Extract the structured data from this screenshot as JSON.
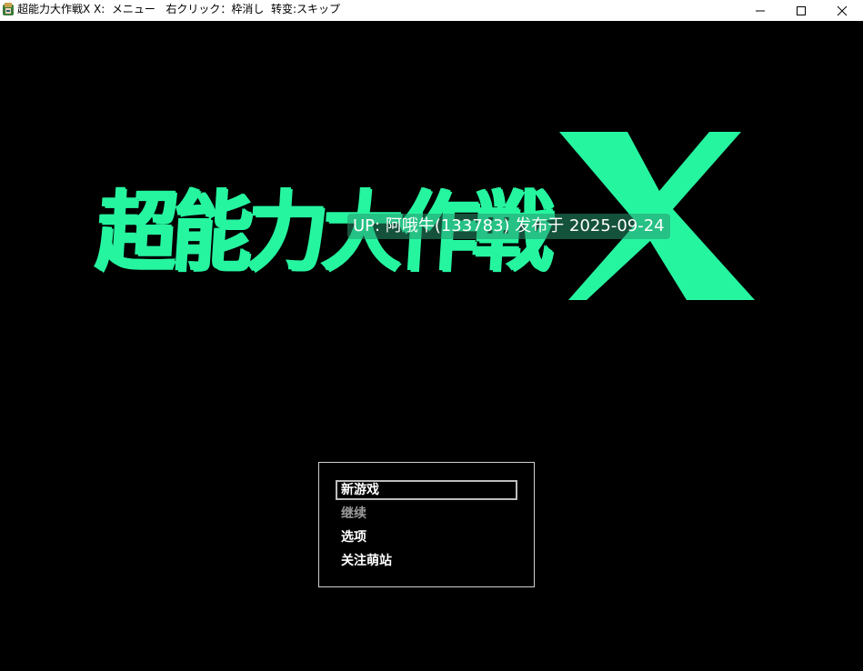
{
  "window": {
    "title": "超能力大作戦X X:  メニュー   右クリック：枠消し  转变:スキップ",
    "min_glyph": "—",
    "max_glyph": "☐",
    "close_glyph": "✕"
  },
  "logo": {
    "text": "超能力大作戦",
    "x_letter": "X",
    "color": "#26f5a0"
  },
  "uploader_badge": "UP: 阿哦牛(133783) 发布于 2025-09-24",
  "menu": {
    "items": [
      {
        "label": "新游戏",
        "state": "selected"
      },
      {
        "label": "继续",
        "state": "disabled"
      },
      {
        "label": "选项",
        "state": "normal"
      },
      {
        "label": "关注萌站",
        "state": "normal"
      }
    ]
  }
}
